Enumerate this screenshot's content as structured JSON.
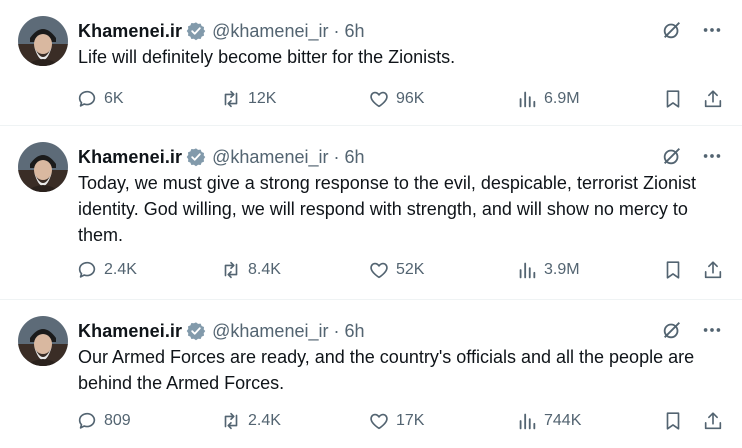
{
  "colors": {
    "text": "#0f1419",
    "secondary": "#536471",
    "verified": "#829aab",
    "divider": "#eff3f4"
  },
  "tweets": [
    {
      "author": {
        "name": "Khamenei.ir",
        "handle": "@khamenei_ir"
      },
      "separator": "·",
      "time": "6h",
      "text": "Life will definitely become bitter for the Zionists.",
      "stats": {
        "replies": "6K",
        "reposts": "12K",
        "likes": "96K",
        "views": "6.9M"
      }
    },
    {
      "author": {
        "name": "Khamenei.ir",
        "handle": "@khamenei_ir"
      },
      "separator": "·",
      "time": "6h",
      "text": "Today, we must give a strong response to the evil, despicable, terrorist Zionist identity. God willing, we will respond with strength, and will show no mercy to them.",
      "stats": {
        "replies": "2.4K",
        "reposts": "8.4K",
        "likes": "52K",
        "views": "3.9M"
      }
    },
    {
      "author": {
        "name": "Khamenei.ir",
        "handle": "@khamenei_ir"
      },
      "separator": "·",
      "time": "6h",
      "text": "Our Armed Forces are ready, and the country's officials and all the people are behind the Armed Forces.",
      "stats": {
        "replies": "809",
        "reposts": "2.4K",
        "likes": "17K",
        "views": "744K"
      }
    }
  ]
}
